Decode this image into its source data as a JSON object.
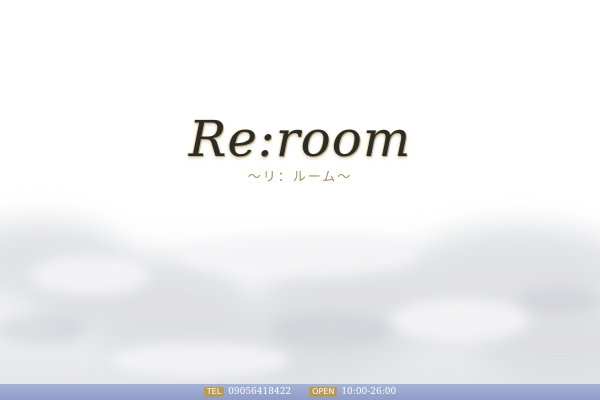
{
  "logo": {
    "title": "Re:room",
    "subtitle": "〜リ：ルーム〜"
  },
  "footer": {
    "tel_label": "TEL",
    "tel_value": "09056418422",
    "open_label": "OPEN",
    "open_value": "10:00-26:00"
  },
  "colors": {
    "footer_bar": "#9aa7cf",
    "badge_gold": "#b89a52",
    "logo_gold": "#c9b27a"
  }
}
